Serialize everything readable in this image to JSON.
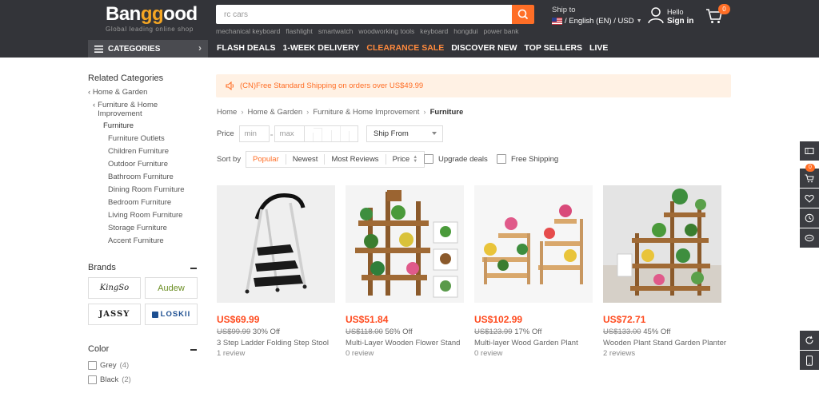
{
  "header": {
    "logo_main_a": "Ban",
    "logo_main_b": "gg",
    "logo_main_c": "ood",
    "logo_tagline": "Global leading online shop",
    "search_value": "rc cars",
    "hot_words": [
      "mechanical keyboard",
      "flashlight",
      "smartwatch",
      "woodworking tools",
      "keyboard",
      "hongdui",
      "power bank"
    ],
    "ship_to_label": "Ship to",
    "ship_to_value": "/ English (EN) / USD",
    "user_hello": "Hello",
    "user_signin": "Sign in",
    "cart_count": "0"
  },
  "nav": {
    "categories_label": "CATEGORIES",
    "links": [
      "FLASH DEALS",
      "1-WEEK DELIVERY",
      "CLEARANCE SALE",
      "DISCOVER NEW",
      "TOP SELLERS",
      "LIVE"
    ]
  },
  "sidebar": {
    "related_title": "Related Categories",
    "parents": [
      "Home & Garden",
      "Furniture & Home Improvement"
    ],
    "current": "Furniture",
    "children": [
      "Furniture Outlets",
      "Children Furniture",
      "Outdoor Furniture",
      "Bathroom Furniture",
      "Dining Room Furniture",
      "Bedroom Furniture",
      "Living Room Furniture",
      "Storage Furniture",
      "Accent Furniture"
    ],
    "brands_title": "Brands",
    "brands": [
      "KingSo",
      "Audew",
      "JASSY",
      "LOSKII"
    ],
    "color_title": "Color",
    "colors": [
      {
        "name": "Grey",
        "count": "(4)"
      },
      {
        "name": "Black",
        "count": "(2)"
      }
    ]
  },
  "promo": {
    "text": "(CN)Free Standard Shipping on orders over US$49.99"
  },
  "breadcrumb": [
    "Home",
    "Home & Garden",
    "Furniture & Home Improvement",
    "Furniture"
  ],
  "filters": {
    "price_label": "Price",
    "min_placeholder": "min",
    "max_placeholder": "max",
    "ship_from": "Ship From",
    "sort_label": "Sort by",
    "sort_options": [
      "Popular",
      "Newest",
      "Most Reviews",
      "Price"
    ],
    "upgrade_deals": "Upgrade deals",
    "free_shipping": "Free Shipping"
  },
  "products": [
    {
      "price": "US$69.99",
      "original": "US$99.99",
      "discount": "30% Off",
      "name": "3 Step Ladder Folding Step Stool",
      "reviews": "1 review"
    },
    {
      "price": "US$51.84",
      "original": "US$118.00",
      "discount": "56% Off",
      "name": "Multi-Layer Wooden Flower Stand",
      "reviews": "0 review"
    },
    {
      "price": "US$102.99",
      "original": "US$123.99",
      "discount": "17% Off",
      "name": "Multi-layer Wood Garden Plant",
      "reviews": "0 review"
    },
    {
      "price": "US$72.71",
      "original": "US$133.00",
      "discount": "45% Off",
      "name": "Wooden Plant Stand Garden Planter",
      "reviews": "2 reviews"
    }
  ],
  "float": {
    "cart_count": "0"
  },
  "colors": {
    "accent": "#ff6e26",
    "header_bg": "#333439",
    "price": "#ff4b1f"
  }
}
